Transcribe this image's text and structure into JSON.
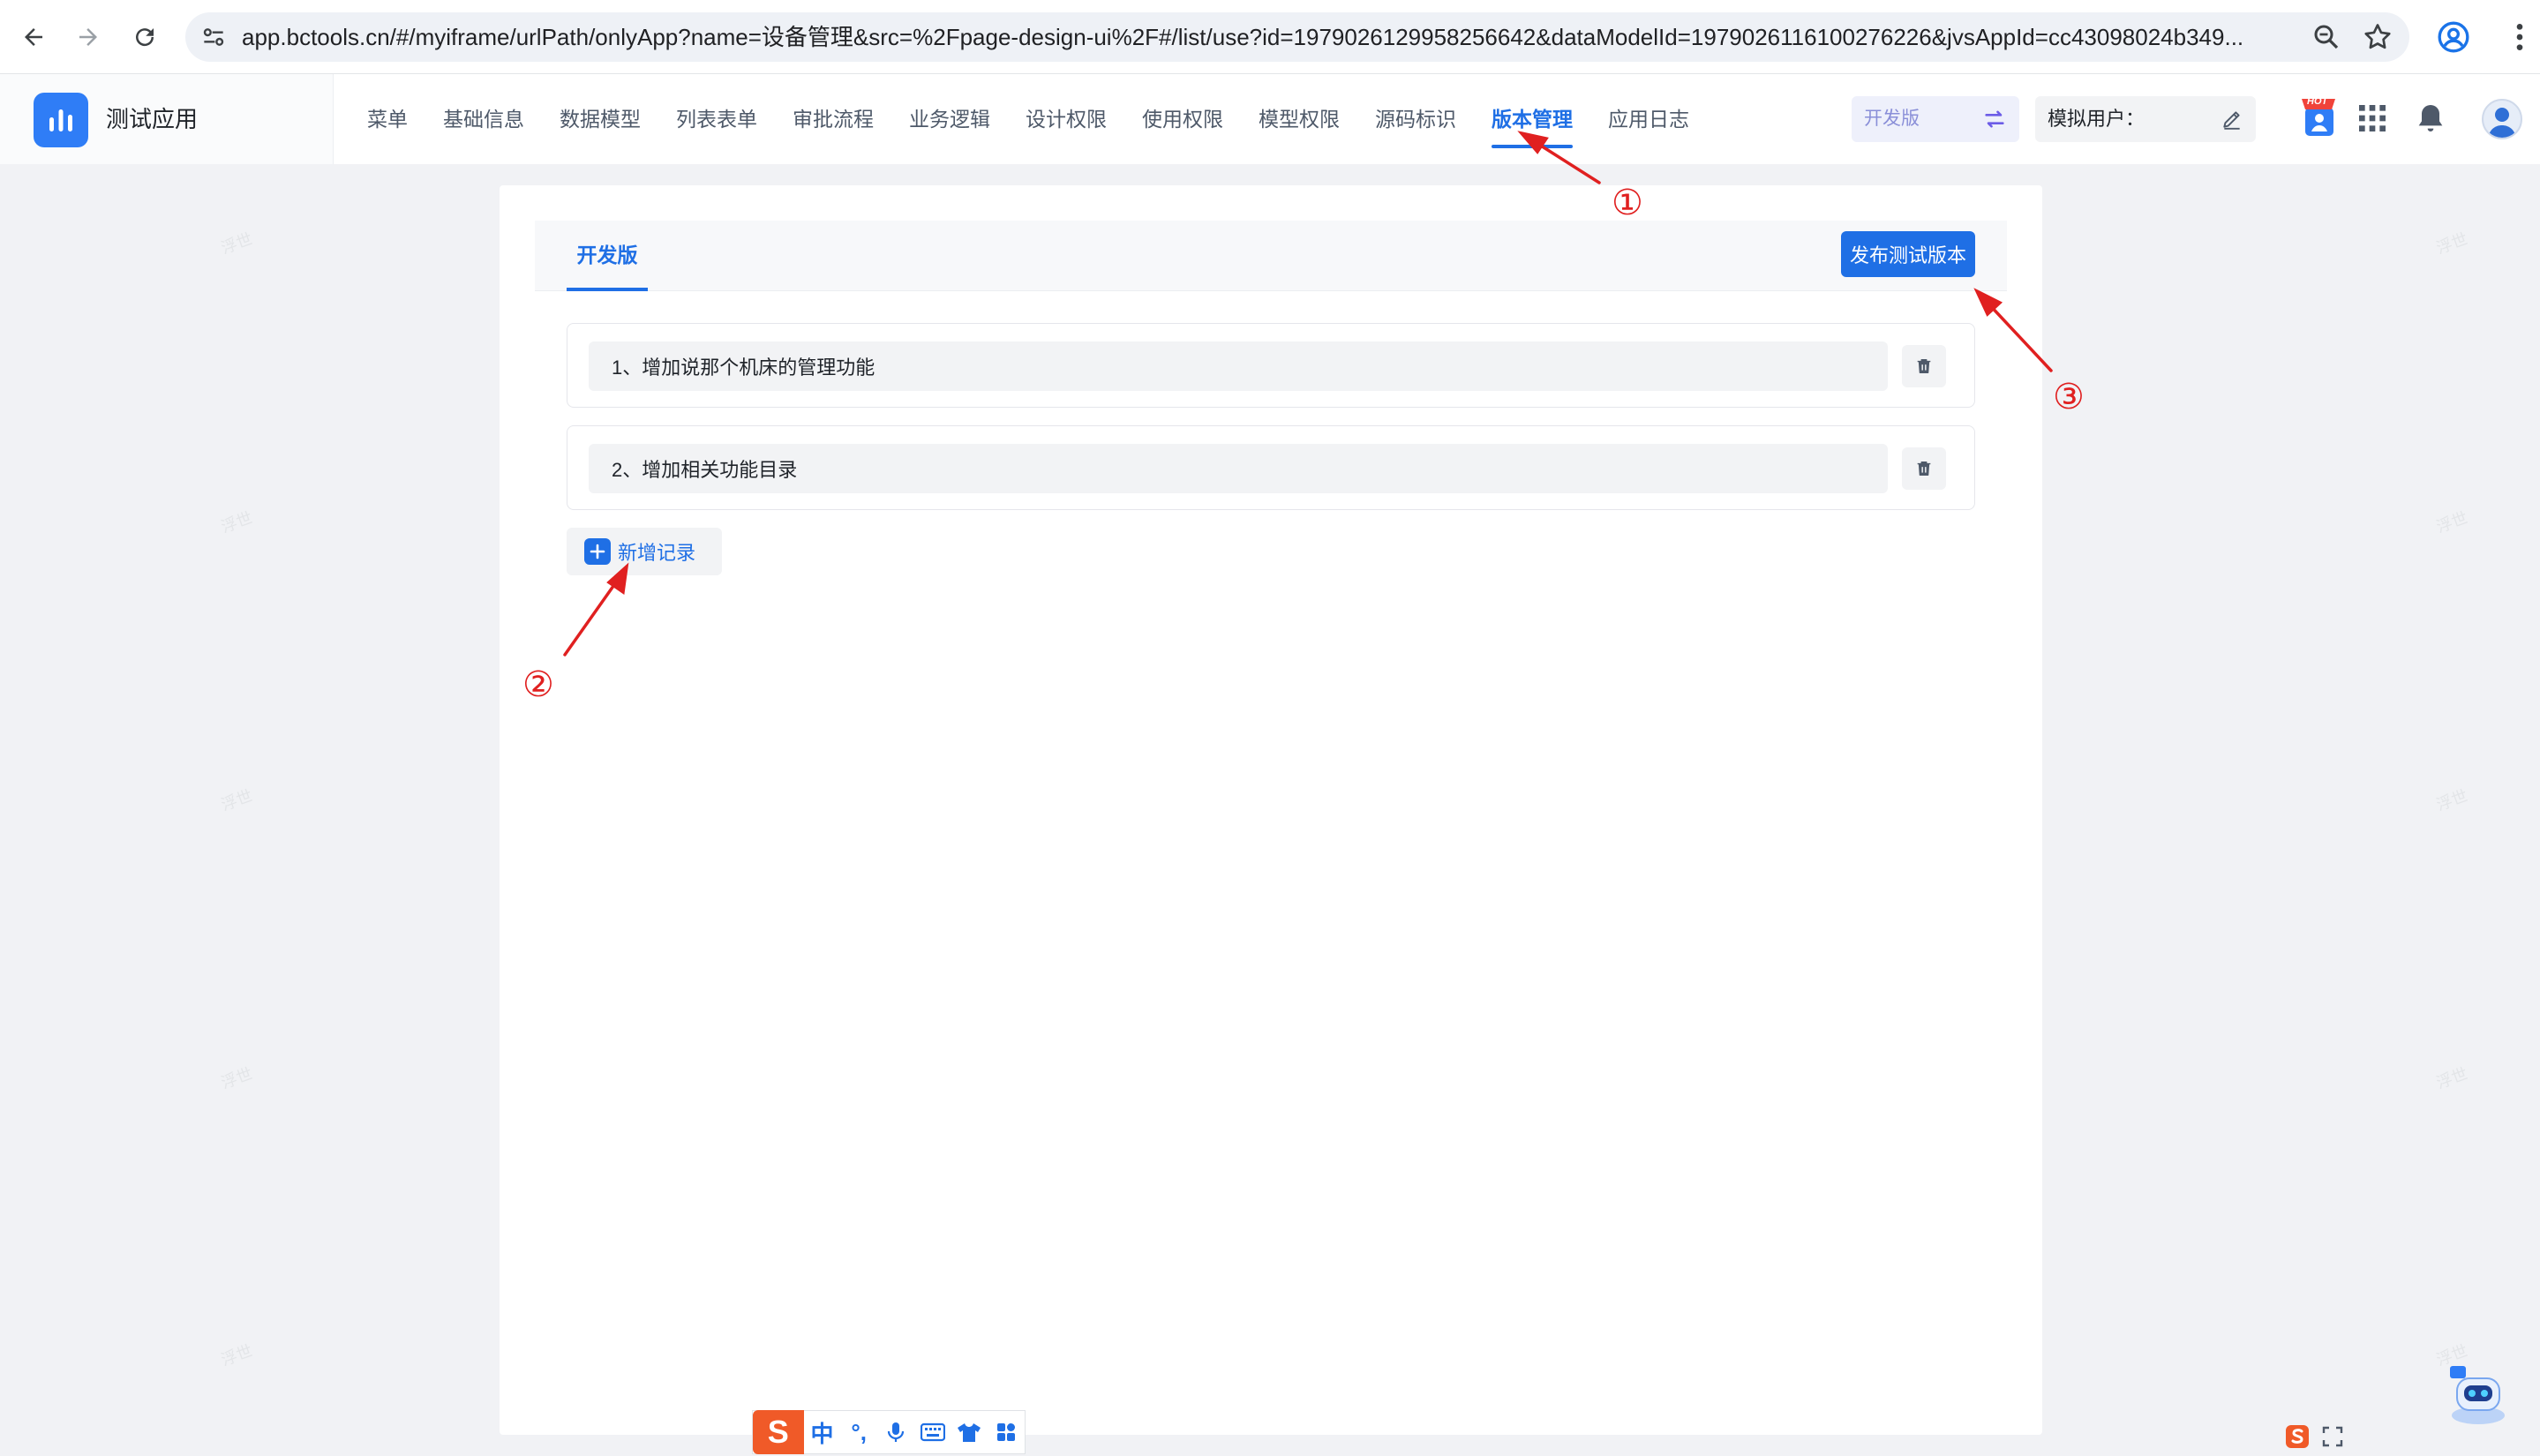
{
  "browser": {
    "url": "app.bctools.cn/#/myiframe/urlPath/onlyApp?name=设备管理&src=%2Fpage-design-ui%2F#/list/use?id=1979026129958256642&dataModelId=1979026116100276226&jvsAppId=cc43098024b349..."
  },
  "app": {
    "name": "测试应用",
    "menu": [
      "菜单",
      "基础信息",
      "数据模型",
      "列表表单",
      "审批流程",
      "业务逻辑",
      "设计权限",
      "使用权限",
      "模型权限",
      "源码标识",
      "版本管理",
      "应用日志"
    ],
    "active_menu": "版本管理",
    "env_label": "开发版",
    "sim_user_label": "模拟用户：",
    "hot_badge": "HOT"
  },
  "main": {
    "tab": "开发版",
    "publish_button": "发布测试版本",
    "records": [
      "1、增加说那个机床的管理功能",
      "2、增加相关功能目录"
    ],
    "add_button": "新增记录"
  },
  "annotations": [
    "①",
    "②",
    "③"
  ],
  "watermark": "浮世",
  "ime": {
    "logo": "S",
    "mode": "中",
    "punct": "°,"
  },
  "colors": {
    "primary": "#1f6fe5",
    "annotation": "#e02020",
    "background": "#f1f2f5"
  }
}
